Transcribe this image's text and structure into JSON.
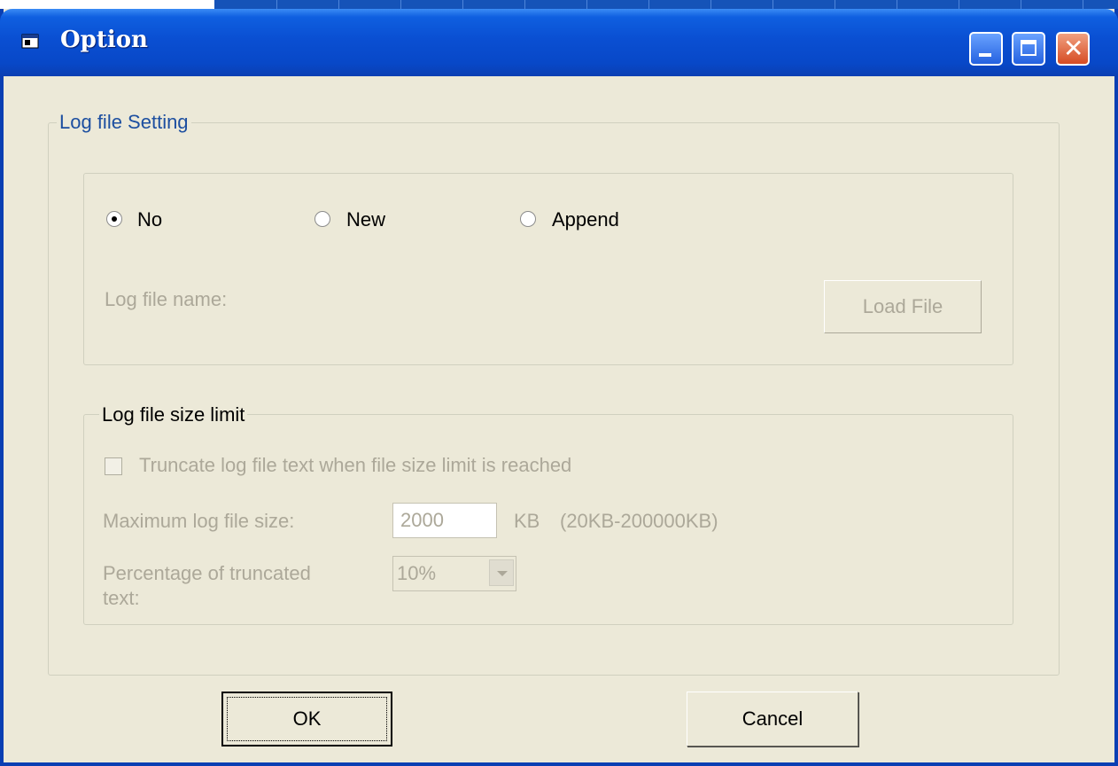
{
  "window": {
    "title": "Option",
    "icons": {
      "app": "window-app-icon",
      "minimize": "minimize-icon",
      "maximize": "maximize-icon",
      "close": "close-icon"
    },
    "close_glyph": "✕"
  },
  "log_setting": {
    "group_label": "Log file Setting",
    "options": [
      {
        "label": "No",
        "selected": true
      },
      {
        "label": "New",
        "selected": false
      },
      {
        "label": "Append",
        "selected": false
      }
    ],
    "file_name_label": "Log file name:",
    "load_file_label": "Load File"
  },
  "size_limit": {
    "group_label": "Log file size limit",
    "truncate_label": "Truncate log file text when file size limit is reached",
    "truncate_checked": false,
    "max_size_label": "Maximum log file size:",
    "max_size_value": "2000",
    "unit": "KB",
    "range": "(20KB-200000KB)",
    "percentage_label_line1": "Percentage of truncated",
    "percentage_label_line2": "text:",
    "percentage_value": "10%"
  },
  "buttons": {
    "ok": "OK",
    "cancel": "Cancel"
  },
  "colors": {
    "titlebar": "#0a4fd2",
    "window_bg": "#ece9d8",
    "group_label": "#1d4fa0",
    "disabled_text": "#aca899"
  }
}
